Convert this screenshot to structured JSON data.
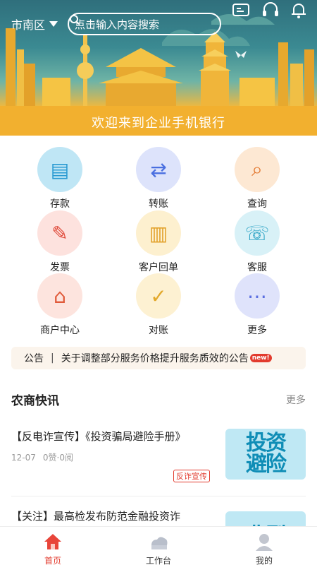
{
  "header": {
    "region": "市南区",
    "search_placeholder": "点击输入内容搜索",
    "banner_title": "欢迎来到企业手机银行"
  },
  "icons_top": [
    "scan-icon",
    "headset-icon",
    "bell-icon"
  ],
  "grid": [
    {
      "label": "存款",
      "icon": "deposit-icon",
      "color": "#bfe6f5"
    },
    {
      "label": "转账",
      "icon": "transfer-icon",
      "color": "#dde3fb"
    },
    {
      "label": "查询",
      "icon": "query-icon",
      "color": "#fde8d3"
    },
    {
      "label": "发票",
      "icon": "invoice-icon",
      "color": "#fde2de"
    },
    {
      "label": "客户回单",
      "icon": "receipt-icon",
      "color": "#fdf0cf"
    },
    {
      "label": "客服",
      "icon": "service-icon",
      "color": "#d8f1f7"
    },
    {
      "label": "商户中心",
      "icon": "merchant-icon",
      "color": "#fde4de"
    },
    {
      "label": "对账",
      "icon": "reconcile-icon",
      "color": "#fdf1d2"
    },
    {
      "label": "更多",
      "icon": "more-icon",
      "color": "#dfe3fb"
    }
  ],
  "notice": {
    "label": "公告",
    "separator": "|",
    "text": "关于调整部分服务价格提升服务质效的公告",
    "badge": "new!"
  },
  "news_section": {
    "title": "农商快讯",
    "more": "更多",
    "items": [
      {
        "title": "【反电诈宣传】《投资骗局避险手册》",
        "date": "12-07",
        "stats": "0赞·0阅",
        "tag": "反诈宣传",
        "thumb": "投资\n避险"
      },
      {
        "title": "【关注】最高检发布防范金融投资诈",
        "date": "",
        "stats": "",
        "tag": "",
        "thumb": "典型"
      }
    ]
  },
  "bottom_nav": [
    {
      "label": "首页",
      "icon": "home-icon",
      "active": true
    },
    {
      "label": "工作台",
      "icon": "workbench-icon",
      "active": false
    },
    {
      "label": "我的",
      "icon": "profile-icon",
      "active": false
    }
  ]
}
